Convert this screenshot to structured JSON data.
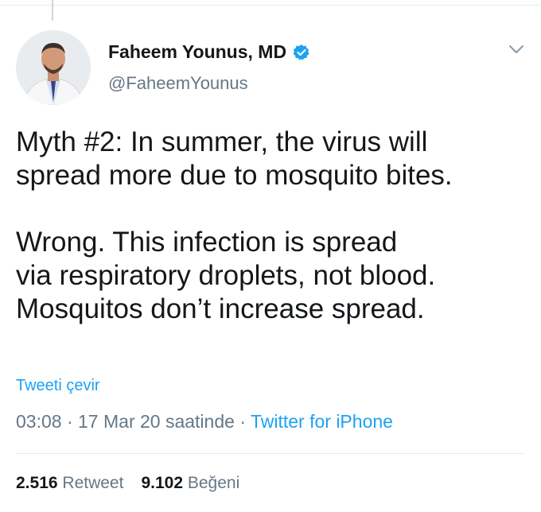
{
  "author": {
    "name": "Faheem Younus, MD",
    "handle": "@FaheemYounus",
    "verified_icon": "verified-badge-icon",
    "accent": "#1da1f2"
  },
  "tweet": {
    "text": "Myth #2: In summer, the virus will\nspread more due to mosquito bites.\n\nWrong. This infection is spread\nvia respiratory droplets, not blood.\nMosquitos don’t increase spread.",
    "translate_label": "Tweeti çevir",
    "time": "03:08",
    "date": "17 Mar 20 saatinde",
    "separator": "·",
    "source": "Twitter for iPhone"
  },
  "stats": {
    "retweets_count": "2.516",
    "retweets_label": "Retweet",
    "likes_count": "9.102",
    "likes_label": "Beğeni"
  }
}
